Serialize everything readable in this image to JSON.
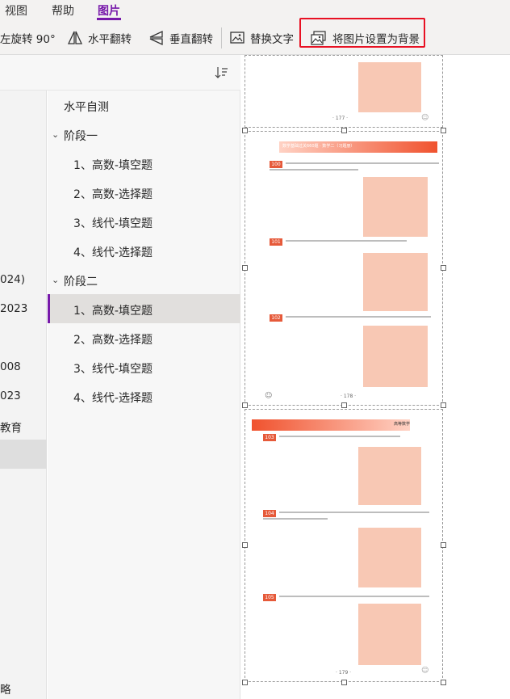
{
  "ribbon": {
    "tabs": [
      {
        "label": "视图",
        "active": false
      },
      {
        "label": "帮助",
        "active": false
      },
      {
        "label": "图片",
        "active": true
      }
    ],
    "tools": [
      {
        "label": "左旋转 90°",
        "icon": "rotate-left-icon"
      },
      {
        "label": "水平翻转",
        "icon": "flip-horizontal-icon"
      },
      {
        "label": "垂直翻转",
        "icon": "flip-vertical-icon"
      },
      {
        "label": "替换文字",
        "icon": "alt-text-icon"
      },
      {
        "label": "将图片设置为背景",
        "icon": "set-as-background-icon"
      }
    ]
  },
  "notebook_pane": {
    "items": [
      "024)",
      "2023",
      "008",
      "023",
      "教育",
      "略"
    ]
  },
  "page_list": {
    "items": [
      {
        "label": "水平自测",
        "level": 0
      },
      {
        "label": "阶段一",
        "level": 0,
        "expanded": true
      },
      {
        "label": "1、高数-填空题",
        "level": 1
      },
      {
        "label": "2、高数-选择题",
        "level": 1
      },
      {
        "label": "3、线代-填空题",
        "level": 1
      },
      {
        "label": "4、线代-选择题",
        "level": 1
      },
      {
        "label": "阶段二",
        "level": 0,
        "expanded": true
      },
      {
        "label": "1、高数-填空题",
        "level": 1,
        "selected": true
      },
      {
        "label": "2、高数-选择题",
        "level": 1
      },
      {
        "label": "3、线代-填空题",
        "level": 1
      },
      {
        "label": "4、线代-选择题",
        "level": 1
      }
    ]
  },
  "canvas": {
    "page_numbers": [
      "· 177 ·",
      "· 178 ·",
      "· 179 ·"
    ],
    "question_numbers": [
      "100",
      "101",
      "102",
      "103",
      "104",
      "105"
    ],
    "header_title": "数学基础过关660题 · 数学二（习题册）",
    "header_right": "高等数学"
  },
  "colors": {
    "accent": "#7719aa",
    "highlight": "#e81123"
  }
}
